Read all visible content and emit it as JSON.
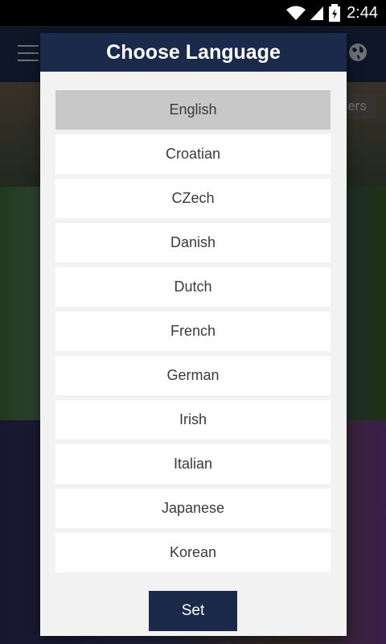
{
  "status_bar": {
    "time": "2:44"
  },
  "background": {
    "partial_label": "ers"
  },
  "dialog": {
    "title": "Choose Language",
    "languages": [
      {
        "label": "English",
        "selected": true
      },
      {
        "label": "Croatian",
        "selected": false
      },
      {
        "label": "CZech",
        "selected": false
      },
      {
        "label": "Danish",
        "selected": false
      },
      {
        "label": "Dutch",
        "selected": false
      },
      {
        "label": "French",
        "selected": false
      },
      {
        "label": "German",
        "selected": false
      },
      {
        "label": "Irish",
        "selected": false
      },
      {
        "label": "Italian",
        "selected": false
      },
      {
        "label": "Japanese",
        "selected": false
      },
      {
        "label": "Korean",
        "selected": false
      }
    ],
    "set_label": "Set"
  },
  "colors": {
    "navy": "#1b2a4a",
    "selected_item": "#c8c8c8",
    "dialog_bg": "#f2f2f2"
  }
}
